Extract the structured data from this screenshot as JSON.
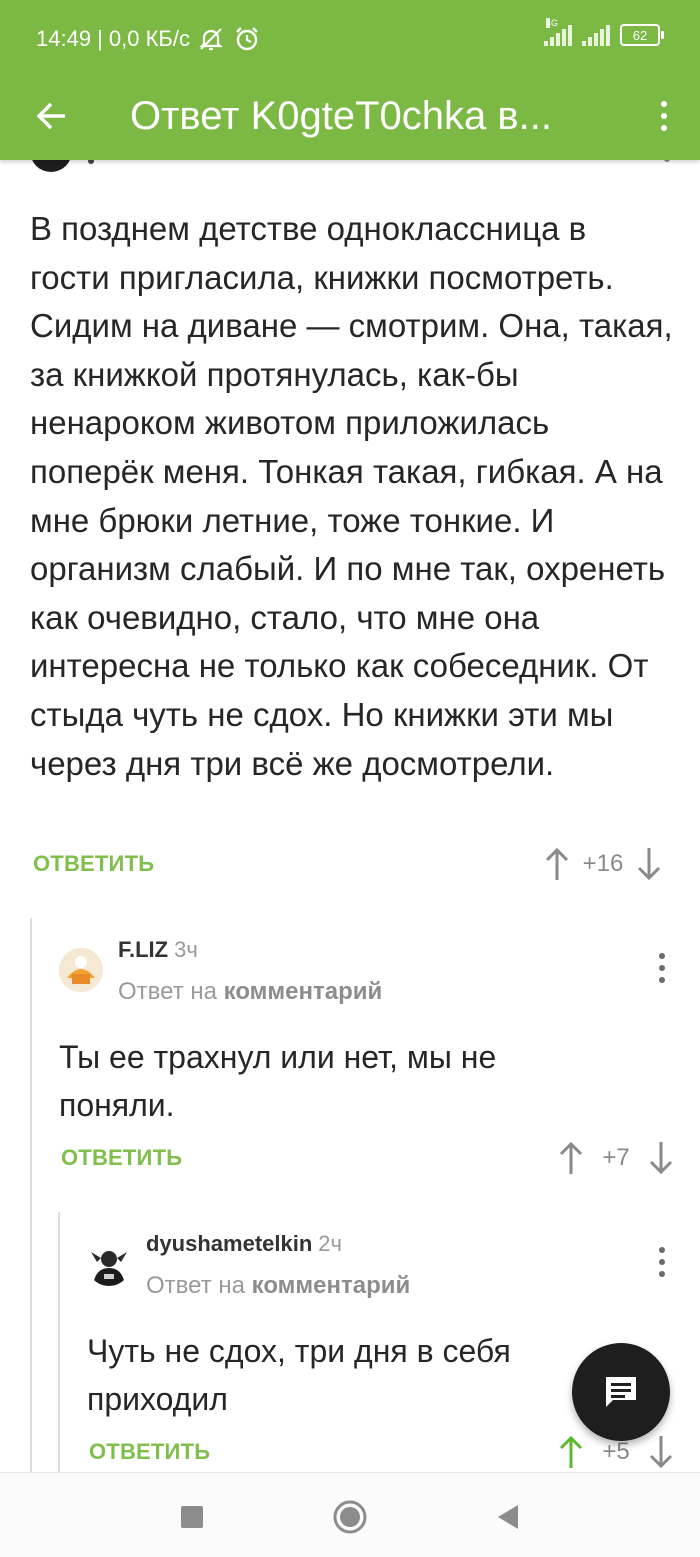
{
  "status_bar": {
    "time": "14:49",
    "speed": "| 0,0 КБ/с",
    "network": "4G",
    "battery": "62"
  },
  "app_bar": {
    "title": "Ответ K0gteT0chka в...",
    "back_icon": "arrow-left-icon",
    "menu_icon": "more-vert-icon",
    "color": "#7cb944"
  },
  "main_comment": {
    "text": "В позднем детстве одноклассница в гости пригласила, книжки посмотреть. Сидим на диване — смотрим. Она, такая, за книжкой протянулась, как-бы ненароком животом приложилась поперёк меня. Тонкая такая, гибкая. А на мне брюки летние, тоже тонкие. И организм слабый. И по мне так, охренеть как очевидно, стало, что мне она интересна не только как собеседник. От стыда чуть не сдох. Но книжки эти мы через дня три всё же досмотрели.",
    "reply_label": "ОТВЕТИТЬ",
    "rating": "+16"
  },
  "comments": [
    {
      "username": "F.LIZ",
      "time": "3ч",
      "reply_prefix": "Ответ на",
      "reply_target": "комментарий",
      "text": "Ты ее трахнул или нет, мы не поняли.",
      "reply_label": "ОТВЕТИТЬ",
      "rating": "+7"
    },
    {
      "username": "dyushametelkin",
      "time": "2ч",
      "reply_prefix": "Ответ на",
      "reply_target": "комментарий",
      "text": "Чуть не сдох, три дня в себя приходил",
      "reply_label": "ОТВЕТИТЬ",
      "rating": "+5"
    }
  ],
  "colors": {
    "accent": "#80bf4b",
    "upvoted": "#5cb82f",
    "fab": "#1e1e1e"
  }
}
